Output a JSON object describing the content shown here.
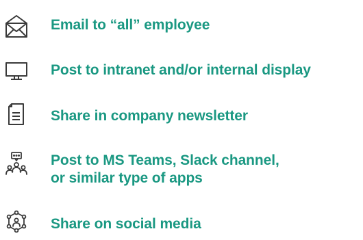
{
  "colors": {
    "accent": "#1a9882",
    "icon": "#3a3a3a"
  },
  "items": [
    {
      "icon": "envelope-icon",
      "label": "Email to “all” employee"
    },
    {
      "icon": "monitor-icon",
      "label": "Post to intranet and/or internal display"
    },
    {
      "icon": "document-icon",
      "label": "Share in company newsletter"
    },
    {
      "icon": "team-chat-icon",
      "label_lines": [
        "Post to MS Teams, Slack channel,",
        "or similar type of apps"
      ]
    },
    {
      "icon": "social-network-icon",
      "label": "Share on social media"
    }
  ]
}
